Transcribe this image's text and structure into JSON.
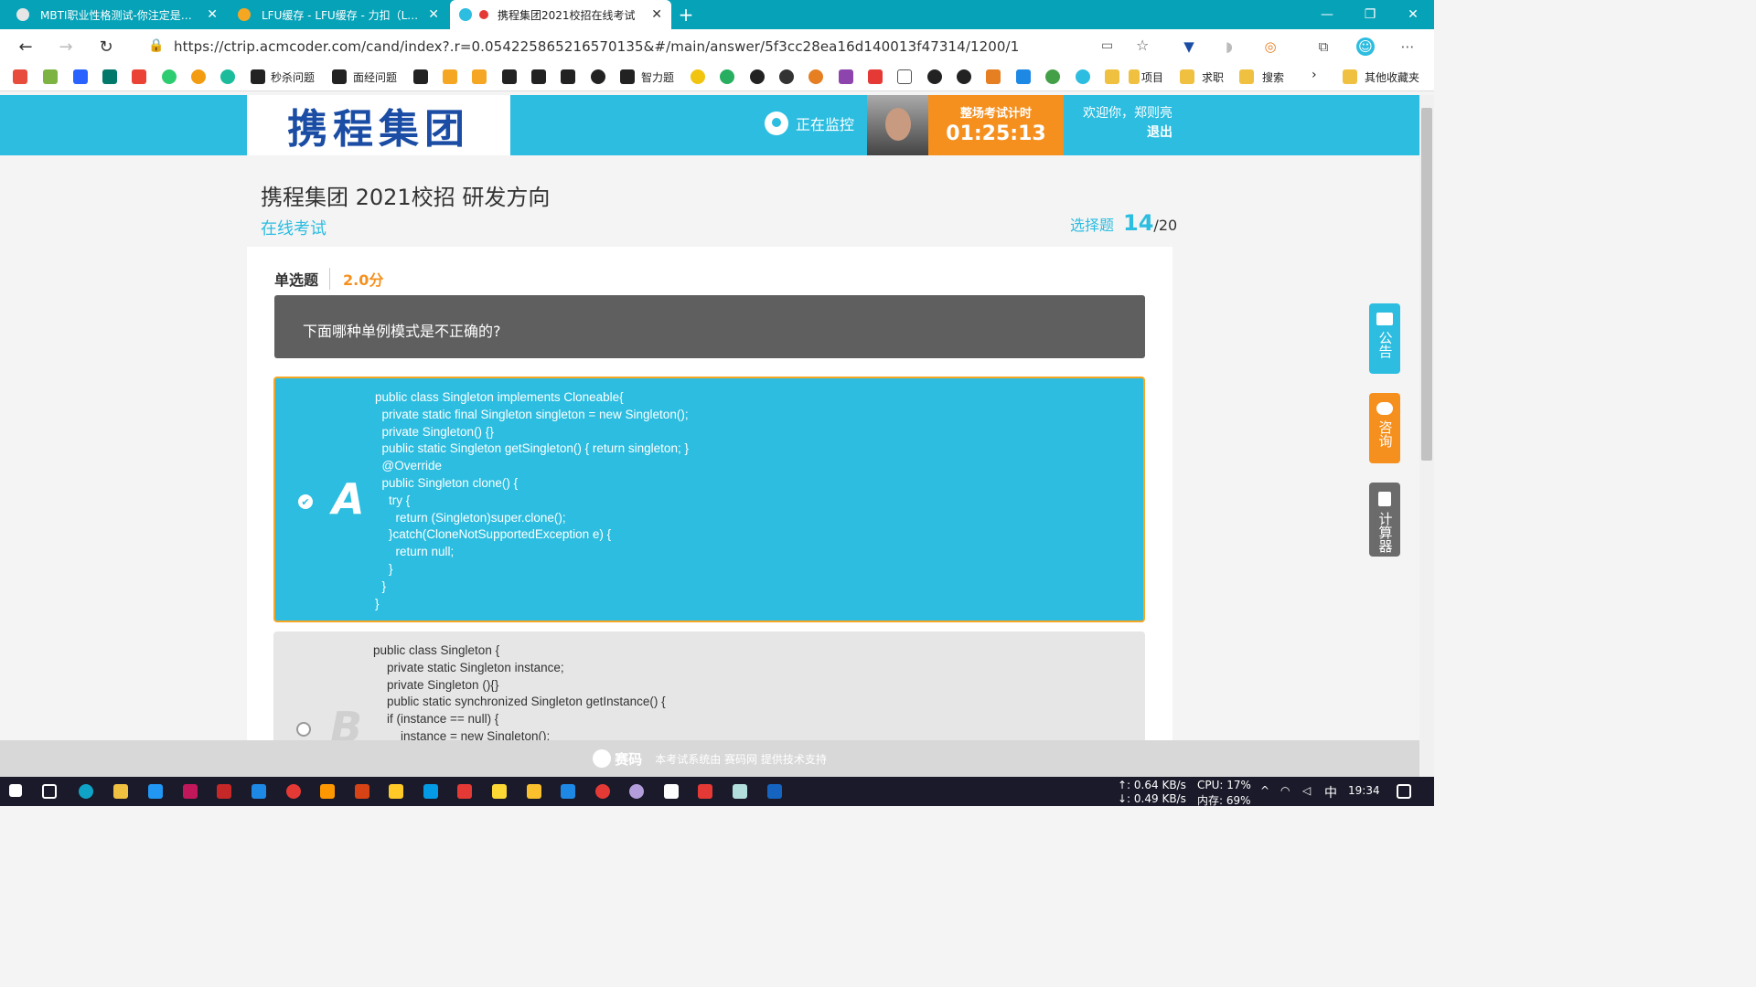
{
  "browser": {
    "tabs": [
      {
        "title": "MBTI职业性格测试-你注定是个租",
        "active": false
      },
      {
        "title": "LFU缓存 - LFU缓存 - 力扣（Leetc",
        "active": false
      },
      {
        "title": "携程集团2021校招在线考试",
        "active": true
      }
    ],
    "url": "https://ctrip.acmcoder.com/cand/index?.r=0.054225865216570135&#/main/answer/5f3cc28ea16d140013f47314/1200/1",
    "bookmarks": [
      "秒杀问题",
      "面经问题",
      "智力题",
      "项目",
      "求职",
      "搜索",
      "其他收藏夹"
    ]
  },
  "header": {
    "logo_text": "携程集团",
    "monitor_label": "正在监控",
    "timer_label": "整场考试计时",
    "timer_value": "01:25:13",
    "welcome": "欢迎你，郑则亮",
    "logout": "退出"
  },
  "exam": {
    "title": "携程集团 2021校招 研发方向",
    "subtitle": "在线考试",
    "section": "选择题",
    "current": "14",
    "total": "/20"
  },
  "question": {
    "type": "单选题",
    "score": "2.0分",
    "text": "下面哪种单例模式是不正确的?",
    "options": [
      {
        "letter": "A",
        "selected": true,
        "code": "public class Singleton implements Cloneable{\n  private static final Singleton singleton = new Singleton();\n  private Singleton() {}\n  public static Singleton getSingleton() { return singleton; }\n  @Override\n  public Singleton clone() {\n    try {\n      return (Singleton)super.clone();\n    }catch(CloneNotSupportedException e) {\n      return null;\n    }\n  }\n}"
      },
      {
        "letter": "B",
        "selected": false,
        "code": "public class Singleton {\n    private static Singleton instance;\n    private Singleton (){}\n    public static synchronized Singleton getInstance() {\n    if (instance == null) {\n        instance = new Singleton();"
      }
    ]
  },
  "side": {
    "notice": "公告",
    "consult": "咨询",
    "calculator": "计算器"
  },
  "footer": {
    "brand": "赛码",
    "text": "本考试系统由 赛码网 提供技术支持"
  },
  "taskbar": {
    "net_up": "↑: 0.64 KB/s",
    "net_down": "↓: 0.49 KB/s",
    "cpu": "CPU: 17%",
    "mem": "内存: 69%",
    "ime": "中",
    "time": "19:34"
  },
  "colors": {
    "accent": "#2cbde0",
    "orange": "#f5901e",
    "tabbar": "#06a2b8"
  }
}
